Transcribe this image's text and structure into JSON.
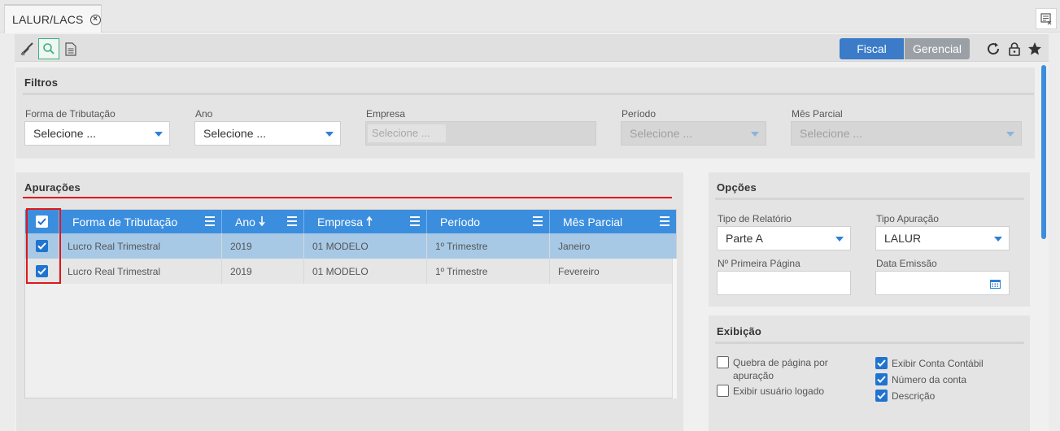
{
  "tab": {
    "label": "LALUR/LACS"
  },
  "toolbar": {
    "fiscal_label": "Fiscal",
    "gerencial_label": "Gerencial"
  },
  "filtros": {
    "title": "Filtros",
    "forma_tributacao": {
      "label": "Forma de Tributação",
      "value": "Selecione ..."
    },
    "ano": {
      "label": "Ano",
      "value": "Selecione ..."
    },
    "empresa": {
      "label": "Empresa",
      "value": "Selecione ..."
    },
    "periodo": {
      "label": "Período",
      "value": "Selecione ..."
    },
    "mes_parcial": {
      "label": "Mês Parcial",
      "value": "Selecione ..."
    }
  },
  "apuracoes": {
    "title": "Apurações",
    "columns": [
      "Forma de Tributação",
      "Ano",
      "Empresa",
      "Período",
      "Mês Parcial"
    ],
    "rows": [
      {
        "checked": true,
        "forma": "Lucro Real Trimestral",
        "ano": "2019",
        "empresa": "01 MODELO",
        "periodo": "1º Trimestre",
        "mes": "Janeiro"
      },
      {
        "checked": true,
        "forma": "Lucro Real Trimestral",
        "ano": "2019",
        "empresa": "01 MODELO",
        "periodo": "1º Trimestre",
        "mes": "Fevereiro"
      }
    ]
  },
  "opcoes": {
    "title": "Opções",
    "tipo_relatorio": {
      "label": "Tipo de Relatório",
      "value": "Parte A"
    },
    "tipo_apuracao": {
      "label": "Tipo Apuração",
      "value": "LALUR"
    },
    "primeira_pagina": {
      "label": "Nº Primeira Página",
      "value": ""
    },
    "data_emissao": {
      "label": "Data Emissão",
      "value": ""
    }
  },
  "exibicao": {
    "title": "Exibição",
    "quebra_pagina": {
      "label": "Quebra de página por apuração",
      "checked": false
    },
    "exibir_usuario": {
      "label": "Exibir usuário logado",
      "checked": false
    },
    "exibir_conta": {
      "label": "Exibir Conta Contábil",
      "checked": true
    },
    "numero_conta": {
      "label": "Número da conta",
      "checked": true
    },
    "descricao": {
      "label": "Descrição",
      "checked": true
    }
  },
  "colors": {
    "accent": "#3b8ede",
    "fiscal": "#3b7bc8",
    "gerencial": "#9aa0a6",
    "highlight": "#e0161c"
  }
}
